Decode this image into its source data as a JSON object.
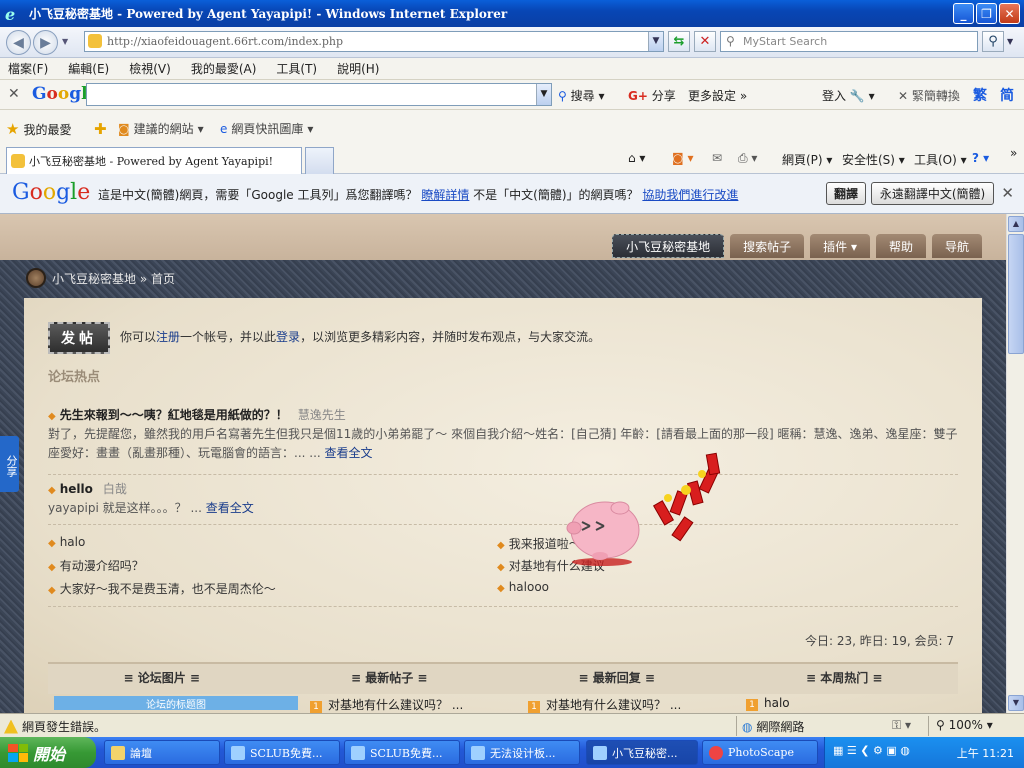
{
  "window": {
    "title": "小飞豆秘密基地 - Powered by Agent Yayapipi! - Windows Internet Explorer",
    "min": "_",
    "max": "❐",
    "close": "✕"
  },
  "address": {
    "url": "http://xiaofeidouagent.66rt.com/index.php",
    "search_placeholder": "MyStart Search"
  },
  "menu": [
    "檔案(F)",
    "編輯(E)",
    "檢視(V)",
    "我的最愛(A)",
    "工具(T)",
    "說明(H)"
  ],
  "google_toolbar": {
    "search_label": "搜尋",
    "share_label": "分享",
    "more_label": "更多設定 »",
    "login_label": "登入",
    "convert_label": "緊簡轉換",
    "trad_label": "繁",
    "simp_label": "简"
  },
  "favorites": {
    "fav_label": "我的最愛",
    "suggested": "建議的網站",
    "gallery": "網頁快訊圖庫"
  },
  "tab": {
    "title": "小飞豆秘密基地 - Powered by Agent Yayapipi!"
  },
  "commands": [
    "網頁(P)",
    "安全性(S)",
    "工具(O)"
  ],
  "translate": {
    "logo": "Google",
    "msg1": "這是中文(簡體)網頁，需要「Google 工具列」爲您翻譯嗎？",
    "learn_more": "瞭解詳情",
    "msg2": "不是「中文(簡體)」的網頁嗎？",
    "help_link": "協助我們進行改進",
    "translate_btn": "翻譯",
    "always_btn": "永遠翻譯中文(簡體)"
  },
  "forum": {
    "nav": [
      "小飞豆秘密基地",
      "搜索帖子",
      "插件 ▾",
      "帮助",
      "导航"
    ],
    "crumb": "小飞豆秘密基地 » 首页",
    "post_btn": "发帖",
    "intro_pre": "你可以",
    "intro_reg": "注册",
    "intro_mid": "一个帐号，并以此",
    "intro_login": "登录",
    "intro_post": "，以浏览更多精彩内容，并随时发布观点，与大家交流。",
    "hot_title": "论坛热点",
    "hot": [
      {
        "title": "先生來報到～～咦？紅地毯是用紙做的？！",
        "author": "慧逸先生",
        "excerpt": "對了，先提醒您，雖然我的用戶名寫著先生但我只是個11歲的小弟弟罷了～ 來個自我介紹～姓名：[自己猜] 年齡：[請看最上面的那一段] 暱稱：慧逸、逸弟、逸星座：雙子座愛好：畫畫（亂畫那種）、玩電腦會的語言：... ...",
        "more": "查看全文"
      },
      {
        "title": "hello",
        "author": "白哉",
        "excerpt": "yayapipi 就是这样。。。？ ...",
        "more": "查看全文"
      }
    ],
    "list_left": [
      "halo",
      "有动漫介绍吗？",
      "大家好～我不是费玉清，也不是周杰伦～"
    ],
    "list_right": [
      "我来报道啦～",
      "对基地有什么建议",
      "halooo"
    ],
    "stats": "今日: 23, 昨日: 19, 会员: 7",
    "table_heads": [
      "≡ 论坛图片 ≡",
      "≡ 最新帖子 ≡",
      "≡ 最新回复 ≡",
      "≡ 本周热门 ≡"
    ],
    "table_row": {
      "pic": "论坛的标题图",
      "c1": "对基地有什么建议吗？ ...",
      "c2": "对基地有什么建议吗？ ...",
      "c3": "halo"
    },
    "share": "分享"
  },
  "status": {
    "error": "網頁發生錯誤。",
    "zone": "網際網路",
    "zoom": "100%"
  },
  "taskbar": {
    "start": "開始",
    "tasks": [
      "論壇",
      "SCLUB免費...",
      "SCLUB免費...",
      "无法设计板...",
      "小飞豆秘密...",
      "PhotoScape"
    ],
    "clock": "上午 11:21"
  }
}
